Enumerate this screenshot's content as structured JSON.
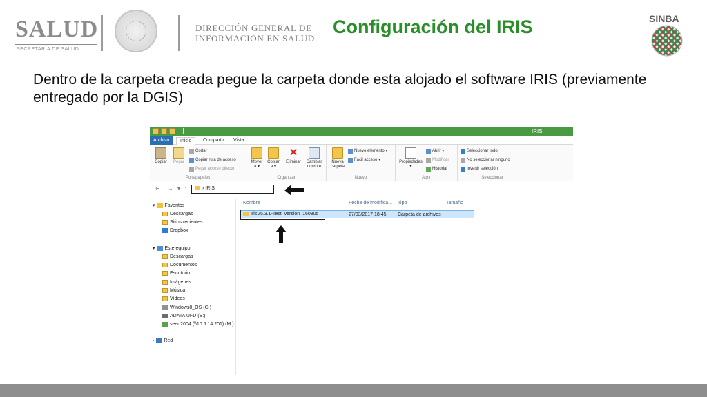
{
  "header": {
    "salud_logo": "SALUD",
    "salud_subtitle": "SECRETARÍA DE SALUD",
    "dgis_line1": "DIRECCIÓN GENERAL DE",
    "dgis_line2": "INFORMACIÓN EN SALUD",
    "slide_title": "Configuración del IRIS",
    "sinba_logo": "SINBA",
    "title_color": "#2a8f2a"
  },
  "instruction": "Dentro de la carpeta creada pegue la carpeta donde esta alojado el software IRIS (previamente entregado por la DGIS)",
  "explorer": {
    "window_title": "IRIS",
    "tabs": [
      "Archivo",
      "Inicio",
      "Compartir",
      "Vista"
    ],
    "portapapeles": {
      "copiar": "Copiar",
      "pegar": "Pegar",
      "cortar": "Cortar",
      "copiar_ruta": "Copiar ruta de acceso",
      "pegar_acceso": "Pegar acceso directo",
      "label": "Portapapeles"
    },
    "organizar": {
      "mover_1": "Mover",
      "mover_2": "a ▾",
      "copiar_1": "Copiar",
      "copiar_2": "a ▾",
      "eliminar": "Eliminar",
      "cambiar_1": "Cambiar",
      "cambiar_2": "nombre",
      "label": "Organizar"
    },
    "nuevo": {
      "nueva_1": "Nueva",
      "nueva_2": "carpeta",
      "nuevo_elemento": "Nuevo elemento ▾",
      "facil_acceso": "Fácil acceso ▾",
      "label": "Nuevo"
    },
    "abrir": {
      "propiedades": "Propiedades",
      "abrir": "Abrir ▾",
      "modificar": "Modificar",
      "historial": "Historial",
      "label": "Abrir"
    },
    "seleccionar": {
      "todo": "Seleccionar todo",
      "ninguno": "No seleccionar ninguno",
      "invertir": "Invertir selección",
      "label": "Seleccionar"
    },
    "address": {
      "path": "IRIS",
      "sep": "›"
    },
    "nav": {
      "favoritos": "Favoritos",
      "descargas": "Descargas",
      "sitios": "Sitios recientes",
      "dropbox": "Dropbox",
      "este_equipo": "Este equipo",
      "descargas2": "Descargas",
      "documentos": "Documentos",
      "escritorio": "Escritorio",
      "imagenes": "Imágenes",
      "musica": "Música",
      "videos": "Vídeos",
      "windows": "Windows8_OS (C:)",
      "adata": "ADATA UFD (E:)",
      "seed": "seed2004 (\\\\10.5.14.201) (M:)",
      "red": "Red"
    },
    "columns": {
      "nombre": "Nombre",
      "fecha": "Fecha de modifica...",
      "tipo": "Tipo",
      "tamano": "Tamaño"
    },
    "file": {
      "name": "IrisV5.3.1-Test_version_160805",
      "date": "27/03/2017 18:45",
      "type": "Carpeta de archivos"
    }
  }
}
